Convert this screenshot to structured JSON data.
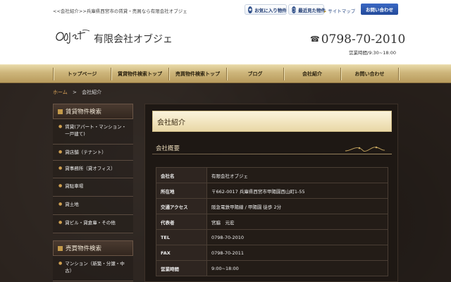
{
  "topbar": {
    "tagline": "<<会社紹介>>兵庫県西宮市の賃貸・売買なら有限会社オブジェ",
    "favorites_label": "お気に入り物件",
    "recent_label": "最近見た物件",
    "sitemap_label": "サイトマップ",
    "contact_label": "お問い合わせ"
  },
  "header": {
    "logo_text": "Objet",
    "company_name": "有限会社オブジェ",
    "phone": "0798-70-2010",
    "hours": "営業時間/9:30~18:00"
  },
  "nav": [
    {
      "label": "トップページ"
    },
    {
      "label": "賃貸物件検索トップ"
    },
    {
      "label": "売買物件検索トップ"
    },
    {
      "label": "ブログ"
    },
    {
      "label": "会社紹介"
    },
    {
      "label": "お問い合わせ"
    }
  ],
  "breadcrumb": {
    "home": "ホーム",
    "separator": ">",
    "current": "会社紹介"
  },
  "sidebar": {
    "rent_heading": "賃貸物件検索",
    "rent_items": [
      {
        "label": "賃貸(アパート・マンション・一戸建て)"
      },
      {
        "label": "貸店舗（テナント）"
      },
      {
        "label": "貸事務所（貸オフィス）"
      },
      {
        "label": "貸駐車場"
      },
      {
        "label": "貸土地"
      },
      {
        "label": "貸ビル・貸倉庫・その他"
      }
    ],
    "sale_heading": "売買物件検索",
    "sale_items": [
      {
        "label": "マンション（新築・分譲・中古）"
      }
    ]
  },
  "main": {
    "page_title": "会社紹介",
    "section_title": "会社概要",
    "rows": [
      {
        "key": "会社名",
        "value": "有限会社オブジェ"
      },
      {
        "key": "所在地",
        "value": "〒662-0017 兵庫県西宮市甲陽園西山町1-55"
      },
      {
        "key": "交通アクセス",
        "value": "阪急電鉄甲陽線 / 甲陽園 徒歩 2分"
      },
      {
        "key": "代表者",
        "value": "宮脇　元宏"
      },
      {
        "key": "TEL",
        "value": "0798-70-2010"
      },
      {
        "key": "FAX",
        "value": "0798-70-2011"
      },
      {
        "key": "営業時間",
        "value": "9:00~18:00"
      }
    ]
  },
  "colors": {
    "nav_gold": "#cdb57a",
    "accent_orange": "#e0a75a",
    "contact_blue": "#2a57b0",
    "dark_bg": "#2a221d"
  }
}
